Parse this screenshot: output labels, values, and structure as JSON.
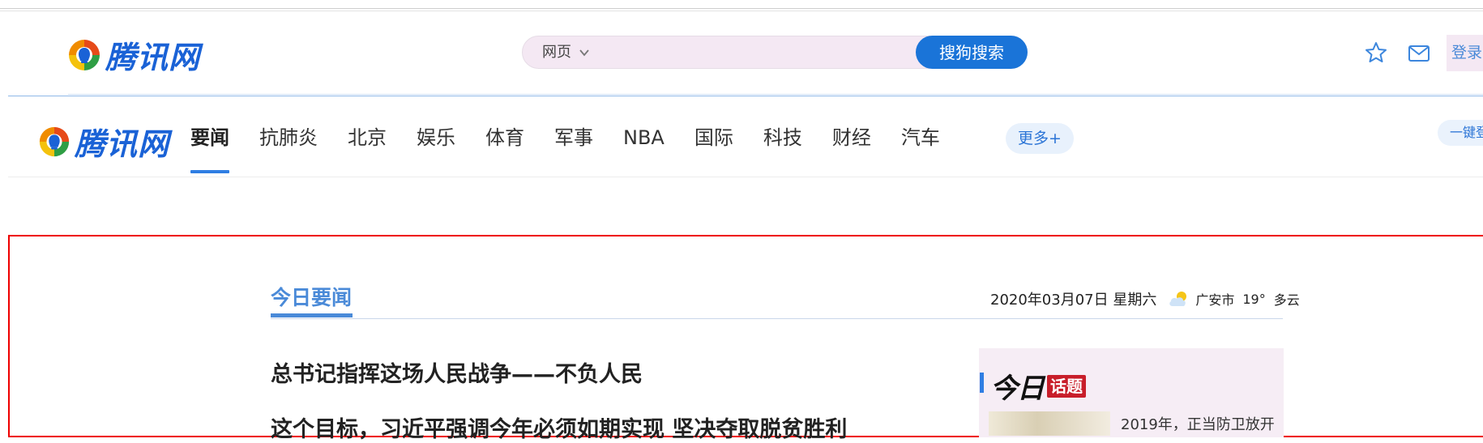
{
  "brand": {
    "name": "腾讯网"
  },
  "search": {
    "type_label": "网页",
    "button_label": "搜狗搜索"
  },
  "header": {
    "login_label": "登录"
  },
  "nav": {
    "items": [
      "要闻",
      "抗肺炎",
      "北京",
      "娱乐",
      "体育",
      "军事",
      "NBA",
      "国际",
      "科技",
      "财经",
      "汽车"
    ],
    "active_index": 0,
    "more_label": "更多+",
    "onekey_label": "一键登"
  },
  "news": {
    "section_title": "今日要闻",
    "date": "2020年03月07日 星期六",
    "weather": {
      "city": "广安市",
      "temp": "19°",
      "condition": "多云"
    },
    "headlines": [
      "总书记指挥这场人民战争——不负人民",
      "这个目标，习近平强调今年必须如期实现 坚决夺取脱贫胜利"
    ]
  },
  "topic": {
    "brand_text": "今日",
    "badge": "话题",
    "snippet": "2019年，正当防卫放开"
  },
  "colors": {
    "brand_blue": "#1a62d6",
    "search_button": "#1a74d8",
    "nav_active_underline": "#2f7ee3",
    "section_blue": "#4a8ad8",
    "highlight_border": "#ee0000",
    "topic_badge": "#c81e2a"
  },
  "icons": {
    "logo": "tencent-logo-icon",
    "dropdown": "chevron-down-icon",
    "favorite": "star-icon",
    "message": "mail-icon",
    "weather": "cloudy-weather-icon"
  }
}
